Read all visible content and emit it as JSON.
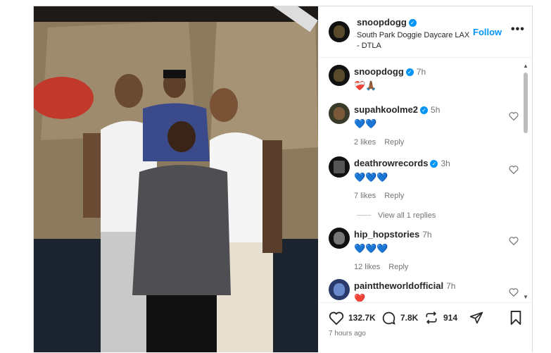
{
  "post": {
    "photo_alt": "Group photo",
    "author": {
      "username": "snoopdogg",
      "location": "South Park Doggie Daycare LAX - DTLA",
      "follow_label": "Follow",
      "more_label": "•••"
    },
    "caption": {
      "username": "snoopdogg",
      "time": "7h",
      "text": "❤️‍🩹🙏🏾"
    },
    "comments": [
      {
        "username": "supahkoolme2",
        "verified": true,
        "time": "5h",
        "text": "💙💙",
        "likes": "2 likes",
        "reply_label": "Reply"
      },
      {
        "username": "deathrowrecords",
        "verified": true,
        "time": "3h",
        "text": "💙💙💙",
        "likes": "7 likes",
        "reply_label": "Reply",
        "view_replies": "View all 1 replies"
      },
      {
        "username": "hip_hopstories",
        "verified": false,
        "time": "7h",
        "text": "💙💙💙",
        "likes": "12 likes",
        "reply_label": "Reply"
      },
      {
        "username": "painttheworldofficial",
        "verified": false,
        "time": "7h",
        "text": "❤️"
      }
    ],
    "actions": {
      "likes_count": "132.7K",
      "comments_count": "7.8K",
      "reposts_count": "914"
    },
    "posted_ago": "7 hours ago"
  }
}
